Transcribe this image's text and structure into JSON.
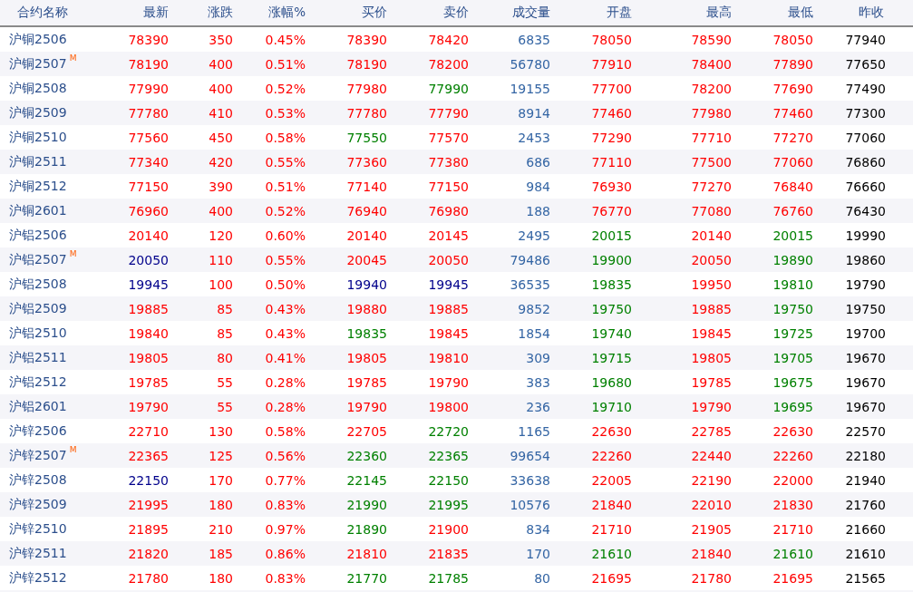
{
  "columns": [
    "合约名称",
    "最新",
    "涨跌",
    "涨幅%",
    "买价",
    "卖价",
    "成交量",
    "开盘",
    "最高",
    "最低",
    "昨收"
  ],
  "rows": [
    {
      "name": "沪铜2506",
      "cells": [
        {
          "text": "78390",
          "color": "#ff0000"
        },
        {
          "text": "350",
          "color": "#ff0000"
        },
        {
          "text": "0.45%",
          "color": "#ff0000"
        },
        {
          "text": "78390",
          "color": "#ff0000"
        },
        {
          "text": "78420",
          "color": "#ff0000"
        },
        {
          "text": "6835",
          "color": "#3465a4"
        },
        {
          "text": "78050",
          "color": "#ff0000"
        },
        {
          "text": "78590",
          "color": "#ff0000"
        },
        {
          "text": "78050",
          "color": "#ff0000"
        },
        {
          "text": "77940",
          "color": "#000000"
        }
      ]
    },
    {
      "name": "沪铜2507",
      "tag": "M",
      "cells": [
        {
          "text": "78190",
          "color": "#ff0000"
        },
        {
          "text": "400",
          "color": "#ff0000"
        },
        {
          "text": "0.51%",
          "color": "#ff0000"
        },
        {
          "text": "78190",
          "color": "#ff0000"
        },
        {
          "text": "78200",
          "color": "#ff0000"
        },
        {
          "text": "56780",
          "color": "#3465a4"
        },
        {
          "text": "77910",
          "color": "#ff0000"
        },
        {
          "text": "78400",
          "color": "#ff0000"
        },
        {
          "text": "77890",
          "color": "#ff0000"
        },
        {
          "text": "77650",
          "color": "#000000"
        }
      ]
    },
    {
      "name": "沪铜2508",
      "cells": [
        {
          "text": "77990",
          "color": "#ff0000"
        },
        {
          "text": "400",
          "color": "#ff0000"
        },
        {
          "text": "0.52%",
          "color": "#ff0000"
        },
        {
          "text": "77980",
          "color": "#ff0000"
        },
        {
          "text": "77990",
          "color": "#008000"
        },
        {
          "text": "19155",
          "color": "#3465a4"
        },
        {
          "text": "77700",
          "color": "#ff0000"
        },
        {
          "text": "78200",
          "color": "#ff0000"
        },
        {
          "text": "77690",
          "color": "#ff0000"
        },
        {
          "text": "77490",
          "color": "#000000"
        }
      ]
    },
    {
      "name": "沪铜2509",
      "cells": [
        {
          "text": "77780",
          "color": "#ff0000"
        },
        {
          "text": "410",
          "color": "#ff0000"
        },
        {
          "text": "0.53%",
          "color": "#ff0000"
        },
        {
          "text": "77780",
          "color": "#ff0000"
        },
        {
          "text": "77790",
          "color": "#ff0000"
        },
        {
          "text": "8914",
          "color": "#3465a4"
        },
        {
          "text": "77460",
          "color": "#ff0000"
        },
        {
          "text": "77980",
          "color": "#ff0000"
        },
        {
          "text": "77460",
          "color": "#ff0000"
        },
        {
          "text": "77300",
          "color": "#000000"
        }
      ]
    },
    {
      "name": "沪铜2510",
      "cells": [
        {
          "text": "77560",
          "color": "#ff0000"
        },
        {
          "text": "450",
          "color": "#ff0000"
        },
        {
          "text": "0.58%",
          "color": "#ff0000"
        },
        {
          "text": "77550",
          "color": "#008000"
        },
        {
          "text": "77570",
          "color": "#ff0000"
        },
        {
          "text": "2453",
          "color": "#3465a4"
        },
        {
          "text": "77290",
          "color": "#ff0000"
        },
        {
          "text": "77710",
          "color": "#ff0000"
        },
        {
          "text": "77270",
          "color": "#ff0000"
        },
        {
          "text": "77060",
          "color": "#000000"
        }
      ]
    },
    {
      "name": "沪铜2511",
      "cells": [
        {
          "text": "77340",
          "color": "#ff0000"
        },
        {
          "text": "420",
          "color": "#ff0000"
        },
        {
          "text": "0.55%",
          "color": "#ff0000"
        },
        {
          "text": "77360",
          "color": "#ff0000"
        },
        {
          "text": "77380",
          "color": "#ff0000"
        },
        {
          "text": "686",
          "color": "#3465a4"
        },
        {
          "text": "77110",
          "color": "#ff0000"
        },
        {
          "text": "77500",
          "color": "#ff0000"
        },
        {
          "text": "77060",
          "color": "#ff0000"
        },
        {
          "text": "76860",
          "color": "#000000"
        }
      ]
    },
    {
      "name": "沪铜2512",
      "cells": [
        {
          "text": "77150",
          "color": "#ff0000"
        },
        {
          "text": "390",
          "color": "#ff0000"
        },
        {
          "text": "0.51%",
          "color": "#ff0000"
        },
        {
          "text": "77140",
          "color": "#ff0000"
        },
        {
          "text": "77150",
          "color": "#ff0000"
        },
        {
          "text": "984",
          "color": "#3465a4"
        },
        {
          "text": "76930",
          "color": "#ff0000"
        },
        {
          "text": "77270",
          "color": "#ff0000"
        },
        {
          "text": "76840",
          "color": "#ff0000"
        },
        {
          "text": "76660",
          "color": "#000000"
        }
      ]
    },
    {
      "name": "沪铜2601",
      "cells": [
        {
          "text": "76960",
          "color": "#ff0000"
        },
        {
          "text": "400",
          "color": "#ff0000"
        },
        {
          "text": "0.52%",
          "color": "#ff0000"
        },
        {
          "text": "76940",
          "color": "#ff0000"
        },
        {
          "text": "76980",
          "color": "#ff0000"
        },
        {
          "text": "188",
          "color": "#3465a4"
        },
        {
          "text": "76770",
          "color": "#ff0000"
        },
        {
          "text": "77080",
          "color": "#ff0000"
        },
        {
          "text": "76760",
          "color": "#ff0000"
        },
        {
          "text": "76430",
          "color": "#000000"
        }
      ]
    },
    {
      "name": "沪铝2506",
      "cells": [
        {
          "text": "20140",
          "color": "#ff0000"
        },
        {
          "text": "120",
          "color": "#ff0000"
        },
        {
          "text": "0.60%",
          "color": "#ff0000"
        },
        {
          "text": "20140",
          "color": "#ff0000"
        },
        {
          "text": "20145",
          "color": "#ff0000"
        },
        {
          "text": "2495",
          "color": "#3465a4"
        },
        {
          "text": "20015",
          "color": "#008000"
        },
        {
          "text": "20140",
          "color": "#ff0000"
        },
        {
          "text": "20015",
          "color": "#008000"
        },
        {
          "text": "19990",
          "color": "#000000"
        }
      ]
    },
    {
      "name": "沪铝2507",
      "tag": "M",
      "cells": [
        {
          "text": "20050",
          "color": "#00008b"
        },
        {
          "text": "110",
          "color": "#ff0000"
        },
        {
          "text": "0.55%",
          "color": "#ff0000"
        },
        {
          "text": "20045",
          "color": "#ff0000"
        },
        {
          "text": "20050",
          "color": "#ff0000"
        },
        {
          "text": "79486",
          "color": "#3465a4"
        },
        {
          "text": "19900",
          "color": "#008000"
        },
        {
          "text": "20050",
          "color": "#ff0000"
        },
        {
          "text": "19890",
          "color": "#008000"
        },
        {
          "text": "19860",
          "color": "#000000"
        }
      ]
    },
    {
      "name": "沪铝2508",
      "cells": [
        {
          "text": "19945",
          "color": "#00008b"
        },
        {
          "text": "100",
          "color": "#ff0000"
        },
        {
          "text": "0.50%",
          "color": "#ff0000"
        },
        {
          "text": "19940",
          "color": "#00008b"
        },
        {
          "text": "19945",
          "color": "#00008b"
        },
        {
          "text": "36535",
          "color": "#3465a4"
        },
        {
          "text": "19835",
          "color": "#008000"
        },
        {
          "text": "19950",
          "color": "#ff0000"
        },
        {
          "text": "19810",
          "color": "#008000"
        },
        {
          "text": "19790",
          "color": "#000000"
        }
      ]
    },
    {
      "name": "沪铝2509",
      "cells": [
        {
          "text": "19885",
          "color": "#ff0000"
        },
        {
          "text": "85",
          "color": "#ff0000"
        },
        {
          "text": "0.43%",
          "color": "#ff0000"
        },
        {
          "text": "19880",
          "color": "#ff0000"
        },
        {
          "text": "19885",
          "color": "#ff0000"
        },
        {
          "text": "9852",
          "color": "#3465a4"
        },
        {
          "text": "19750",
          "color": "#008000"
        },
        {
          "text": "19885",
          "color": "#ff0000"
        },
        {
          "text": "19750",
          "color": "#008000"
        },
        {
          "text": "19750",
          "color": "#000000"
        }
      ]
    },
    {
      "name": "沪铝2510",
      "cells": [
        {
          "text": "19840",
          "color": "#ff0000"
        },
        {
          "text": "85",
          "color": "#ff0000"
        },
        {
          "text": "0.43%",
          "color": "#ff0000"
        },
        {
          "text": "19835",
          "color": "#008000"
        },
        {
          "text": "19845",
          "color": "#ff0000"
        },
        {
          "text": "1854",
          "color": "#3465a4"
        },
        {
          "text": "19740",
          "color": "#008000"
        },
        {
          "text": "19845",
          "color": "#ff0000"
        },
        {
          "text": "19725",
          "color": "#008000"
        },
        {
          "text": "19700",
          "color": "#000000"
        }
      ]
    },
    {
      "name": "沪铝2511",
      "cells": [
        {
          "text": "19805",
          "color": "#ff0000"
        },
        {
          "text": "80",
          "color": "#ff0000"
        },
        {
          "text": "0.41%",
          "color": "#ff0000"
        },
        {
          "text": "19805",
          "color": "#ff0000"
        },
        {
          "text": "19810",
          "color": "#ff0000"
        },
        {
          "text": "309",
          "color": "#3465a4"
        },
        {
          "text": "19715",
          "color": "#008000"
        },
        {
          "text": "19805",
          "color": "#ff0000"
        },
        {
          "text": "19705",
          "color": "#008000"
        },
        {
          "text": "19670",
          "color": "#000000"
        }
      ]
    },
    {
      "name": "沪铝2512",
      "cells": [
        {
          "text": "19785",
          "color": "#ff0000"
        },
        {
          "text": "55",
          "color": "#ff0000"
        },
        {
          "text": "0.28%",
          "color": "#ff0000"
        },
        {
          "text": "19785",
          "color": "#ff0000"
        },
        {
          "text": "19790",
          "color": "#ff0000"
        },
        {
          "text": "383",
          "color": "#3465a4"
        },
        {
          "text": "19680",
          "color": "#008000"
        },
        {
          "text": "19785",
          "color": "#ff0000"
        },
        {
          "text": "19675",
          "color": "#008000"
        },
        {
          "text": "19670",
          "color": "#000000"
        }
      ]
    },
    {
      "name": "沪铝2601",
      "cells": [
        {
          "text": "19790",
          "color": "#ff0000"
        },
        {
          "text": "55",
          "color": "#ff0000"
        },
        {
          "text": "0.28%",
          "color": "#ff0000"
        },
        {
          "text": "19790",
          "color": "#ff0000"
        },
        {
          "text": "19800",
          "color": "#ff0000"
        },
        {
          "text": "236",
          "color": "#3465a4"
        },
        {
          "text": "19710",
          "color": "#008000"
        },
        {
          "text": "19790",
          "color": "#ff0000"
        },
        {
          "text": "19695",
          "color": "#008000"
        },
        {
          "text": "19670",
          "color": "#000000"
        }
      ]
    },
    {
      "name": "沪锌2506",
      "cells": [
        {
          "text": "22710",
          "color": "#ff0000"
        },
        {
          "text": "130",
          "color": "#ff0000"
        },
        {
          "text": "0.58%",
          "color": "#ff0000"
        },
        {
          "text": "22705",
          "color": "#ff0000"
        },
        {
          "text": "22720",
          "color": "#008000"
        },
        {
          "text": "1165",
          "color": "#3465a4"
        },
        {
          "text": "22630",
          "color": "#ff0000"
        },
        {
          "text": "22785",
          "color": "#ff0000"
        },
        {
          "text": "22630",
          "color": "#ff0000"
        },
        {
          "text": "22570",
          "color": "#000000"
        }
      ]
    },
    {
      "name": "沪锌2507",
      "tag": "M",
      "cells": [
        {
          "text": "22365",
          "color": "#ff0000"
        },
        {
          "text": "125",
          "color": "#ff0000"
        },
        {
          "text": "0.56%",
          "color": "#ff0000"
        },
        {
          "text": "22360",
          "color": "#008000"
        },
        {
          "text": "22365",
          "color": "#008000"
        },
        {
          "text": "99654",
          "color": "#3465a4"
        },
        {
          "text": "22260",
          "color": "#ff0000"
        },
        {
          "text": "22440",
          "color": "#ff0000"
        },
        {
          "text": "22260",
          "color": "#ff0000"
        },
        {
          "text": "22180",
          "color": "#000000"
        }
      ]
    },
    {
      "name": "沪锌2508",
      "cells": [
        {
          "text": "22150",
          "color": "#00008b"
        },
        {
          "text": "170",
          "color": "#ff0000"
        },
        {
          "text": "0.77%",
          "color": "#ff0000"
        },
        {
          "text": "22145",
          "color": "#008000"
        },
        {
          "text": "22150",
          "color": "#008000"
        },
        {
          "text": "33638",
          "color": "#3465a4"
        },
        {
          "text": "22005",
          "color": "#ff0000"
        },
        {
          "text": "22190",
          "color": "#ff0000"
        },
        {
          "text": "22000",
          "color": "#ff0000"
        },
        {
          "text": "21940",
          "color": "#000000"
        }
      ]
    },
    {
      "name": "沪锌2509",
      "cells": [
        {
          "text": "21995",
          "color": "#ff0000"
        },
        {
          "text": "180",
          "color": "#ff0000"
        },
        {
          "text": "0.83%",
          "color": "#ff0000"
        },
        {
          "text": "21990",
          "color": "#008000"
        },
        {
          "text": "21995",
          "color": "#008000"
        },
        {
          "text": "10576",
          "color": "#3465a4"
        },
        {
          "text": "21840",
          "color": "#ff0000"
        },
        {
          "text": "22010",
          "color": "#ff0000"
        },
        {
          "text": "21830",
          "color": "#ff0000"
        },
        {
          "text": "21760",
          "color": "#000000"
        }
      ]
    },
    {
      "name": "沪锌2510",
      "cells": [
        {
          "text": "21895",
          "color": "#ff0000"
        },
        {
          "text": "210",
          "color": "#ff0000"
        },
        {
          "text": "0.97%",
          "color": "#ff0000"
        },
        {
          "text": "21890",
          "color": "#008000"
        },
        {
          "text": "21900",
          "color": "#ff0000"
        },
        {
          "text": "834",
          "color": "#3465a4"
        },
        {
          "text": "21710",
          "color": "#ff0000"
        },
        {
          "text": "21905",
          "color": "#ff0000"
        },
        {
          "text": "21710",
          "color": "#ff0000"
        },
        {
          "text": "21660",
          "color": "#000000"
        }
      ]
    },
    {
      "name": "沪锌2511",
      "cells": [
        {
          "text": "21820",
          "color": "#ff0000"
        },
        {
          "text": "185",
          "color": "#ff0000"
        },
        {
          "text": "0.86%",
          "color": "#ff0000"
        },
        {
          "text": "21810",
          "color": "#ff0000"
        },
        {
          "text": "21835",
          "color": "#ff0000"
        },
        {
          "text": "170",
          "color": "#3465a4"
        },
        {
          "text": "21610",
          "color": "#008000"
        },
        {
          "text": "21840",
          "color": "#ff0000"
        },
        {
          "text": "21610",
          "color": "#008000"
        },
        {
          "text": "21610",
          "color": "#000000"
        }
      ]
    },
    {
      "name": "沪锌2512",
      "cells": [
        {
          "text": "21780",
          "color": "#ff0000"
        },
        {
          "text": "180",
          "color": "#ff0000"
        },
        {
          "text": "0.83%",
          "color": "#ff0000"
        },
        {
          "text": "21770",
          "color": "#008000"
        },
        {
          "text": "21785",
          "color": "#008000"
        },
        {
          "text": "80",
          "color": "#3465a4"
        },
        {
          "text": "21695",
          "color": "#ff0000"
        },
        {
          "text": "21780",
          "color": "#ff0000"
        },
        {
          "text": "21695",
          "color": "#ff0000"
        },
        {
          "text": "21565",
          "color": "#000000"
        }
      ]
    }
  ]
}
